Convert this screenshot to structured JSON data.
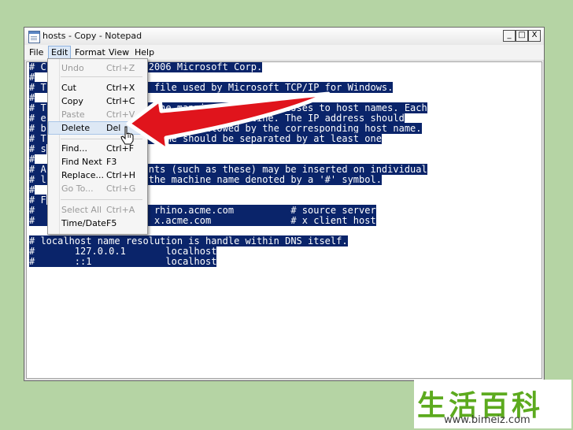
{
  "window": {
    "title": "hosts - Copy - Notepad",
    "minimize_glyph": "_",
    "maximize_glyph": "□",
    "close_glyph": "X"
  },
  "menubar": {
    "items": [
      "File",
      "Edit",
      "Format",
      "View",
      "Help"
    ]
  },
  "edit_menu": {
    "undo": {
      "label": "Undo",
      "shortcut": "Ctrl+Z"
    },
    "cut": {
      "label": "Cut",
      "shortcut": "Ctrl+X"
    },
    "copy": {
      "label": "Copy",
      "shortcut": "Ctrl+C"
    },
    "paste": {
      "label": "Paste",
      "shortcut": "Ctrl+V"
    },
    "delete": {
      "label": "Delete",
      "shortcut": "Del"
    },
    "find": {
      "label": "Find...",
      "shortcut": "Ctrl+F"
    },
    "find_next": {
      "label": "Find Next",
      "shortcut": "F3"
    },
    "replace": {
      "label": "Replace...",
      "shortcut": "Ctrl+H"
    },
    "goto": {
      "label": "Go To...",
      "shortcut": "Ctrl+G"
    },
    "select_all": {
      "label": "Select All",
      "shortcut": "Ctrl+A"
    },
    "time_date": {
      "label": "Time/Date",
      "shortcut": "F5"
    }
  },
  "document": {
    "lines": [
      "# C                 -2006 Microsoft Corp.",
      "#",
      "# T             HOSTS file used by Microsoft TCP/IP for Windows.",
      "#",
      "# T                   the mappings of IP addresses to host names. Each",
      "# e                   on an individual line. The IP address should",
      "# b                   column followed by the corresponding host name.",
      "# T                   name should be separated by at least one",
      "# s",
      "#",
      "# A                ments (such as these) may be inserted on individual",
      "# l                g the machine name denoted by a '#' symbol.",
      "#",
      "# F",
      "#                     rhino.acme.com          # source server",
      "#       38.25.63.10   x.acme.com              # x client host",
      "",
      "# localhost name resolution is handle within DNS itself.",
      "#       127.0.0.1       localhost",
      "#       ::1             localhost"
    ]
  },
  "watermark": {
    "chars": "生活百科",
    "url": "www.bimeiz.com"
  },
  "colors": {
    "selection": "#0a246a",
    "background": "#b5d4a4",
    "arrow": "#e0141c",
    "watermark_green": "#5caa1e"
  }
}
